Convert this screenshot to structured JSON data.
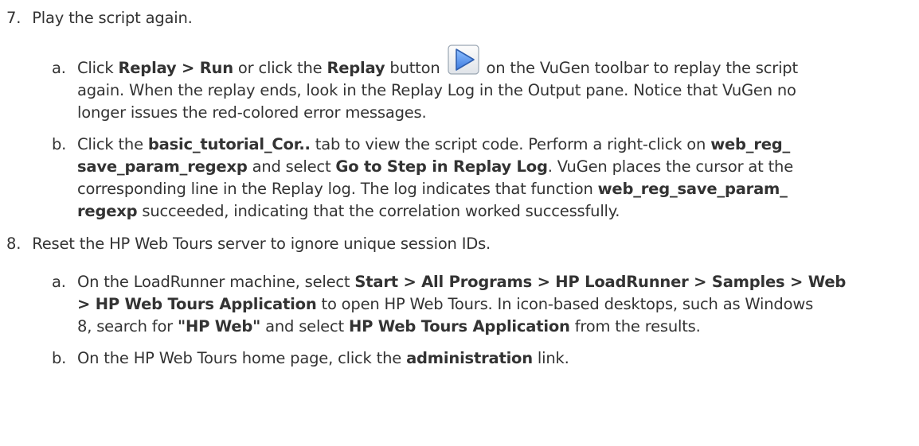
{
  "steps": [
    {
      "number": "7.",
      "text": "Play the script again.",
      "substeps": [
        {
          "marker": "a.",
          "lines": [
            [
              "Click ",
              "*Replay > Run",
              " or click the ",
              "*Replay",
              " button ",
              "[replay-button]",
              " on the VuGen toolbar to replay the script"
            ],
            [
              "again. When the replay ends, look in the Replay Log in the Output pane. Notice that VuGen no"
            ],
            [
              "longer issues the red-colored error messages."
            ]
          ]
        },
        {
          "marker": "b.",
          "lines": [
            [
              "Click the ",
              "*basic_tutorial_Cor..",
              " tab to view the script code. Perform a right-click on ",
              "*web_reg_"
            ],
            [
              "*save_param_regexp",
              " and select ",
              "*Go to Step in Replay Log",
              ". VuGen places the cursor at the"
            ],
            [
              "corresponding line in the Replay log. The log indicates that function ",
              "*web_reg_save_param_"
            ],
            [
              "*regexp",
              " succeeded, indicating that the correlation worked successfully."
            ]
          ]
        }
      ]
    },
    {
      "number": "8.",
      "text": "Reset the HP Web Tours server to ignore unique session IDs.",
      "substeps": [
        {
          "marker": "a.",
          "lines": [
            [
              "On the LoadRunner machine, select ",
              "*Start > All Programs > HP LoadRunner > Samples > Web"
            ],
            [
              "*> HP Web Tours Application",
              " to open HP Web Tours. In icon-based desktops, such as Windows"
            ],
            [
              "8, search for ",
              "*\"HP Web\"",
              " and select ",
              "*HP Web Tours Application",
              " from the results."
            ]
          ]
        },
        {
          "marker": "b.",
          "lines": [
            [
              "On the HP Web Tours home page, click the ",
              "*administration",
              " link."
            ]
          ]
        }
      ]
    }
  ],
  "icons": {
    "replay_button": "replay-play-icon"
  },
  "colors": {
    "text": "#333333",
    "replay_icon_fill": "#3d7be0",
    "replay_icon_frame": "#9aa6b2"
  }
}
